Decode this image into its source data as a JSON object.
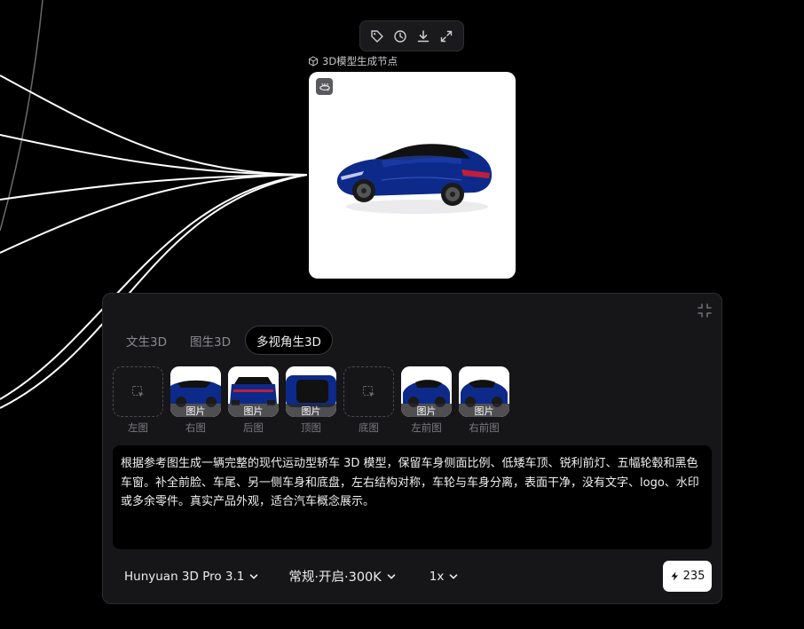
{
  "node": {
    "title": "3D模型生成节点",
    "badge_icon": "rotate-360-icon",
    "toolbar": [
      {
        "name": "tag-icon"
      },
      {
        "name": "history-icon"
      },
      {
        "name": "download-icon"
      },
      {
        "name": "expand-icon"
      }
    ]
  },
  "panel": {
    "tabs": [
      {
        "label": "文生3D",
        "active": false
      },
      {
        "label": "图生3D",
        "active": false
      },
      {
        "label": "多视角生3D",
        "active": true
      }
    ],
    "views": [
      {
        "label": "左图",
        "filled": false,
        "tag": ""
      },
      {
        "label": "右图",
        "filled": true,
        "tag": "图片"
      },
      {
        "label": "后图",
        "filled": true,
        "tag": "图片"
      },
      {
        "label": "顶图",
        "filled": true,
        "tag": "图片"
      },
      {
        "label": "底图",
        "filled": false,
        "tag": ""
      },
      {
        "label": "左前图",
        "filled": true,
        "tag": "图片"
      },
      {
        "label": "右前图",
        "filled": true,
        "tag": "图片"
      }
    ],
    "prompt": "根据参考图生成一辆完整的现代运动型轿车 3D 模型，保留车身侧面比例、低矮车顶、锐利前灯、五幅轮毂和黑色车窗。补全前脸、车尾、另一侧车身和底盘，左右结构对称，车轮与车身分离，表面干净，没有文字、logo、水印或多余零件。真实产品外观，适合汽车概念展示。",
    "model_select": "Hunyuan 3D Pro 3.1",
    "mode_select": "常规·开启·300K",
    "multiplier_select": "1x",
    "credits": "235"
  },
  "colors": {
    "car_body": "#0d2a8a",
    "panel_bg": "#161618",
    "accent_white": "#ffffff"
  }
}
